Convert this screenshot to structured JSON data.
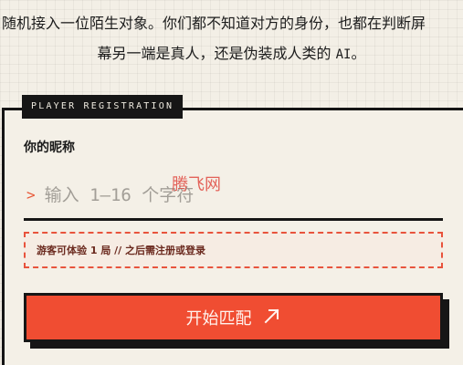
{
  "intro": {
    "line1": "随机接入一位陌生对象。你们都不知道对方的身份，也都在判断屏",
    "line2_prefix": "幕另一端是真人，还是伪装成人类的 ",
    "line2_ai": "AI",
    "line2_suffix": "。"
  },
  "registration": {
    "tag": "PLAYER REGISTRATION",
    "nickname_label": "你的昵称",
    "prompt_symbol": ">",
    "nickname_placeholder": "输入 1–16 个字符",
    "nickname_value": "",
    "watermark": "腾飞网",
    "guest_note": "游客可体验 1 局 // 之后需注册或登录",
    "start_button_label": "开始匹配",
    "start_button_icon": "arrow-up-right-icon"
  },
  "colors": {
    "accent": "#f04d32",
    "ink": "#161616",
    "paper": "#f3efe6"
  }
}
